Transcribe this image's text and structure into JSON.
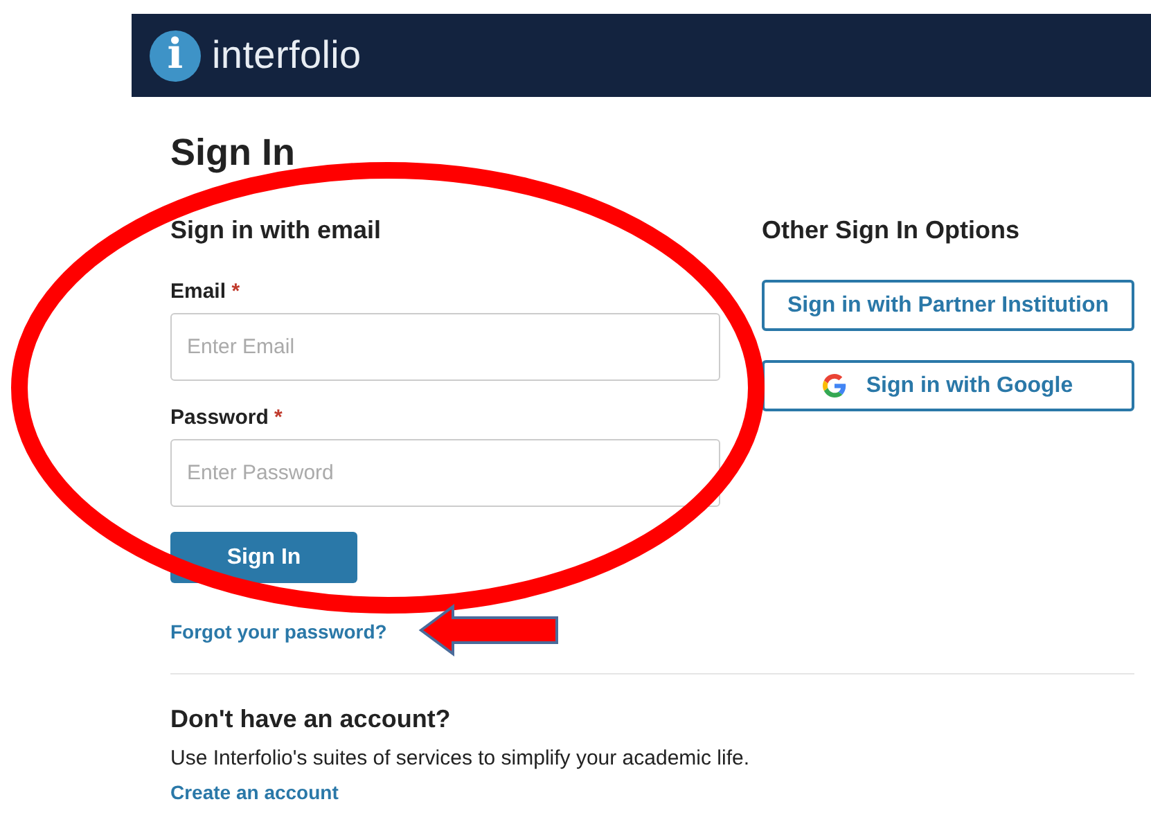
{
  "header": {
    "logo_glyph": "i",
    "brand": "interfolio"
  },
  "title": "Sign In",
  "email_section": {
    "heading": "Sign in with email",
    "fields": [
      {
        "label": "Email",
        "required_mark": "*",
        "placeholder": "Enter Email"
      },
      {
        "label": "Password",
        "required_mark": "*",
        "placeholder": "Enter Password"
      }
    ],
    "submit": "Sign In",
    "forgot_link": "Forgot your password?"
  },
  "other_options": {
    "heading": "Other Sign In Options",
    "buttons": [
      {
        "label": "Sign in with Partner Institution",
        "kind": "plain"
      },
      {
        "label": "Sign in with Google",
        "kind": "google"
      }
    ]
  },
  "signup": {
    "heading": "Don't have an account?",
    "text": "Use Interfolio's suites of services to simplify your academic life.",
    "link": "Create an account"
  },
  "annotations": {
    "highlight_ellipse": true,
    "pointer_arrow": true
  }
}
